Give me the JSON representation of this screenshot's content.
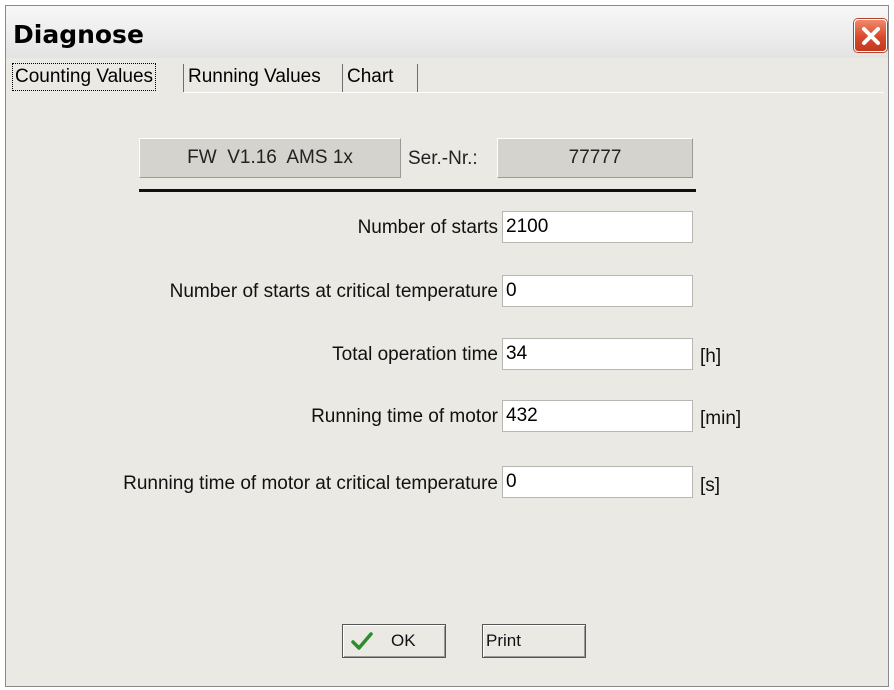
{
  "window": {
    "title": "Diagnose"
  },
  "tabs": [
    {
      "label": "Counting Values",
      "active": true
    },
    {
      "label": "Running Values",
      "active": false
    },
    {
      "label": "Chart",
      "active": false
    }
  ],
  "info": {
    "firmware": "FW  V1.16  AMS 1x",
    "serial_label": "Ser.-Nr.:",
    "serial_value": "77777"
  },
  "fields": [
    {
      "label": "Number of starts",
      "value": "2100",
      "unit": ""
    },
    {
      "label": "Number of starts at critical temperature",
      "value": "0",
      "unit": ""
    },
    {
      "label": "Total operation time",
      "value": "34",
      "unit": "[h]"
    },
    {
      "label": "Running time of motor",
      "value": "432",
      "unit": "[min]"
    },
    {
      "label": "Running time of motor at critical temperature",
      "value": "0",
      "unit": "[s]"
    }
  ],
  "buttons": {
    "ok_label": "OK",
    "print_label": "Print"
  },
  "colors": {
    "close_button": "#d9482a",
    "check_icon": "#2e8b2e",
    "window_bg": "#ebe9e3"
  }
}
